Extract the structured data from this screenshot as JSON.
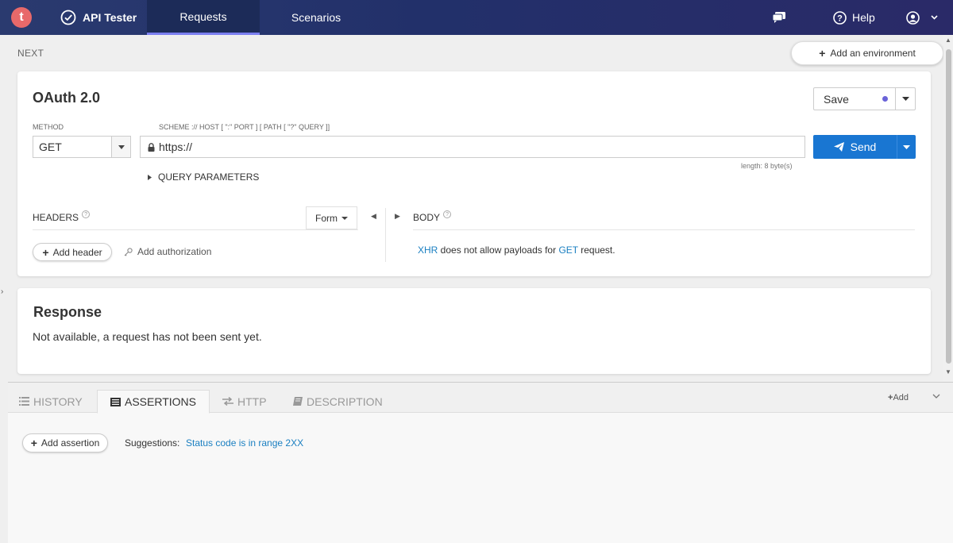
{
  "app": {
    "logo_letter": "t",
    "name": "API Tester"
  },
  "nav": {
    "tabs": [
      {
        "label": "Requests",
        "active": true
      },
      {
        "label": "Scenarios",
        "active": false
      }
    ],
    "help_label": "Help"
  },
  "workspace": {
    "breadcrumb": "NEXT",
    "add_environment_label": "Add an environment"
  },
  "request": {
    "title": "OAuth 2.0",
    "save_label": "Save",
    "method_label": "METHOD",
    "method_value": "GET",
    "url_label": "SCHEME :// HOST [ \":\" PORT ] [ PATH [ \"?\" QUERY ]]",
    "url_value": "https://",
    "length_label": "length: 8 byte(s)",
    "send_label": "Send",
    "query_params_label": "QUERY PARAMETERS",
    "headers_label": "HEADERS",
    "form_label": "Form",
    "add_header_label": "Add header",
    "add_authorization_label": "Add authorization",
    "body_label": "BODY",
    "body_msg": {
      "xhr": "XHR",
      "middle": " does not allow payloads for ",
      "method": "GET",
      "end": " request."
    }
  },
  "response": {
    "title": "Response",
    "message": "Not available, a request has not been sent yet."
  },
  "bottom": {
    "tabs": [
      {
        "label": "HISTORY"
      },
      {
        "label": "ASSERTIONS"
      },
      {
        "label": "HTTP"
      },
      {
        "label": "DESCRIPTION"
      }
    ],
    "add_label": "Add",
    "add_assertion_label": "Add assertion",
    "suggestions_label": "Suggestions:",
    "suggestion_link": "Status code is in range 2XX"
  },
  "colors": {
    "accent": "#1976d2",
    "link": "#1a7fc1",
    "logo": "#e8696a",
    "tab_underline": "#7b7ff0"
  }
}
